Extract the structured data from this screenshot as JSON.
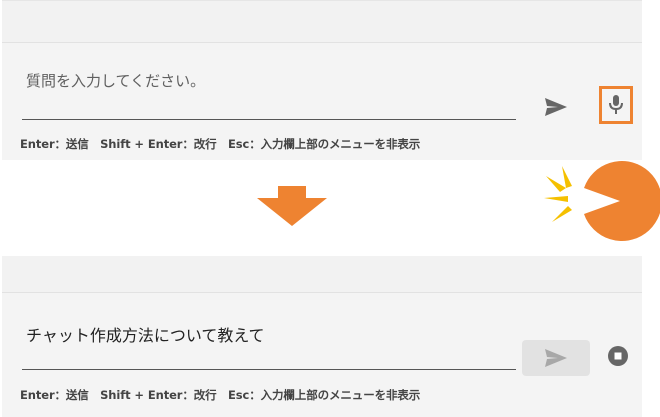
{
  "before": {
    "input": {
      "placeholder": "質問を入力してください。",
      "value": ""
    },
    "send_icon": "send-icon",
    "mic_icon": "microphone-icon",
    "mic_highlight_color": "#ee8331",
    "hint": "Enter：送信　Shift + Enter：改行　Esc：入力欄上部のメニューを非表示"
  },
  "transition": {
    "arrow_icon": "down-arrow-icon",
    "mascot_icon": "pacman-icon",
    "arrow_color": "#ee8331",
    "mascot_color": "#ee8331",
    "sparkle_color": "#f5c000"
  },
  "after": {
    "input": {
      "value": "チャット作成方法について教えて"
    },
    "send_icon": "send-icon",
    "stop_icon": "stop-icon",
    "hint": "Enter：送信　Shift + Enter：改行　Esc：入力欄上部のメニューを非表示"
  }
}
